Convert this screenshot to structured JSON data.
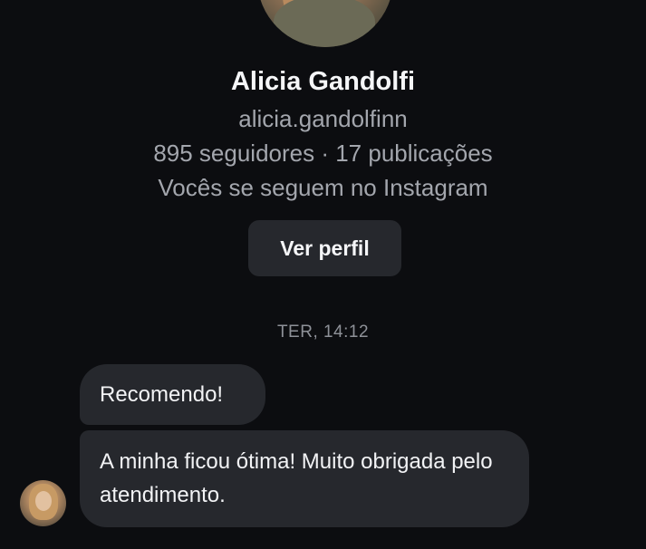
{
  "profile": {
    "name": "Alicia Gandolfi",
    "handle": "alicia.gandolfinn",
    "stats": "895 seguidores · 17 publicações",
    "mutual": "Vocês se seguem no Instagram",
    "view_profile_label": "Ver perfil",
    "avatar_icon": "profile-photo"
  },
  "conversation": {
    "timestamp": "TER, 14:12",
    "messages": [
      {
        "text": "Recomendo!"
      },
      {
        "text": "A minha ficou ótima! Muito obrigada pelo atendimento."
      }
    ],
    "sender_avatar_icon": "sender-photo"
  },
  "colors": {
    "background": "#0c0d10",
    "bubble": "#26282d",
    "primary_text": "#f2f3f5",
    "secondary_text": "#a3a6ad"
  }
}
